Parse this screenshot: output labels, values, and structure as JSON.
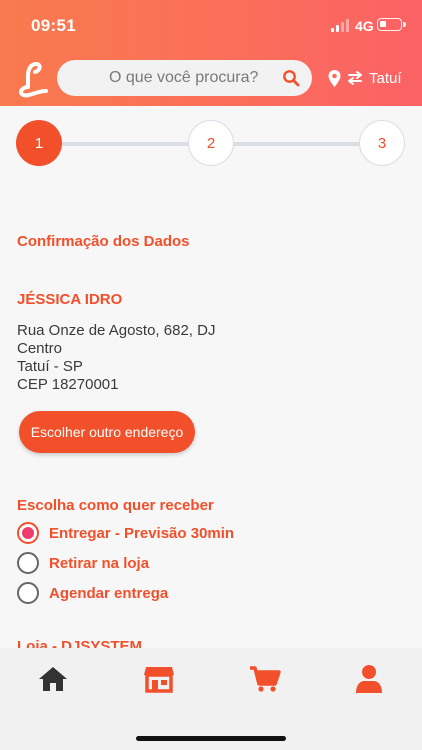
{
  "status": {
    "time": "09:51",
    "network": "4G"
  },
  "header": {
    "search_placeholder": "O que você procura?",
    "location_city": "Tatuí"
  },
  "stepper": {
    "steps": [
      "1",
      "2",
      "3"
    ],
    "active_step": 1
  },
  "confirmation": {
    "title": "Confirmação dos Dados",
    "name": "JÉSSICA IDRO",
    "address_lines": [
      "Rua Onze de Agosto, 682, DJ",
      "Centro",
      "Tatuí - SP",
      "CEP 18270001"
    ],
    "change_address_button": "Escolher outro endereço"
  },
  "delivery": {
    "title": "Escolha como quer receber",
    "options": [
      {
        "label": "Entregar - Previsão 30min",
        "selected": true
      },
      {
        "label": "Retirar na loja",
        "selected": false
      },
      {
        "label": "Agendar entrega",
        "selected": false
      }
    ]
  },
  "store": {
    "label": "Loja - DJSYSTEM"
  },
  "tabs": [
    {
      "icon": "home-icon",
      "active": false
    },
    {
      "icon": "store-icon",
      "active": true
    },
    {
      "icon": "cart-icon",
      "active": true
    },
    {
      "icon": "user-icon",
      "active": true
    }
  ],
  "colors": {
    "accent": "#f24f2b",
    "header_start": "#f97a4e",
    "header_end": "#fb6165",
    "radio_dot": "#ee3c6c"
  }
}
